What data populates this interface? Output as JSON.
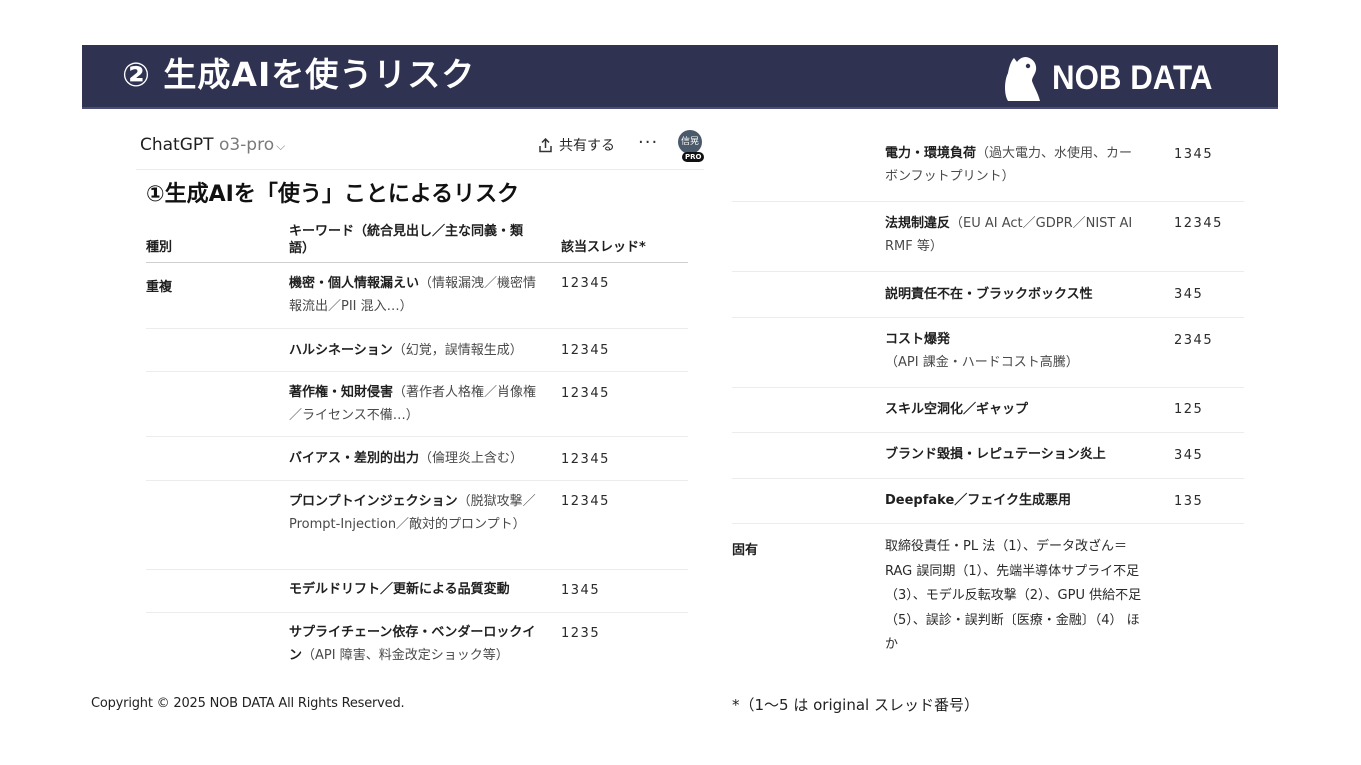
{
  "banner": {
    "title": "② 生成AIを使うリスク",
    "logo_text": "NOB DATA"
  },
  "chat": {
    "model_name": "ChatGPT",
    "model_version": "o3-pro",
    "share_label": "共有する",
    "more_label": "···",
    "avatar_text": "信晃",
    "pro_badge": "PRO",
    "heading": "①生成AIを「使う」ことによるリスク"
  },
  "table": {
    "headers": {
      "category": "種別",
      "keyword": "キーワード（統合見出し／主な同義・類語）",
      "threads": "該当スレッド*"
    },
    "rows": [
      {
        "category": "重複",
        "title": "機密・個人情報漏えい",
        "note": "（情報漏洩／機密情報流出／PII 混入…）",
        "threads": "12345"
      },
      {
        "category": "",
        "title": "ハルシネーション",
        "note": "（幻覚，誤情報生成）",
        "threads": "12345"
      },
      {
        "category": "",
        "title": "著作権・知財侵害",
        "note": "（著作者人格権／肖像権／ライセンス不備…）",
        "threads": "12345"
      },
      {
        "category": "",
        "title": "バイアス・差別的出力",
        "note": "（倫理炎上含む）",
        "threads": "12345"
      },
      {
        "category": "",
        "title": "プロンプトインジェクション",
        "note": "（脱獄攻撃／Prompt-Injection／敵対的プロンプト）",
        "threads": "12345"
      },
      {
        "category": "",
        "title": "モデルドリフト／更新による品質変動",
        "note": "",
        "threads": "1345"
      },
      {
        "category": "",
        "title": "サプライチェーン依存・ベンダーロックイン",
        "note": "（API 障害、料金改定ショック等）",
        "threads": "1235"
      },
      {
        "category": "",
        "title": "電力・環境負荷",
        "note": "（過大電力、水使用、カーボンフットプリント）",
        "threads": "1345"
      },
      {
        "category": "",
        "title": "法規制違反",
        "note": "（EU AI Act／GDPR／NIST AI RMF 等）",
        "threads": "12345"
      },
      {
        "category": "",
        "title": "説明責任不在・ブラックボックス性",
        "note": "",
        "threads": "345"
      },
      {
        "category": "",
        "title": "コスト爆発",
        "note": "（API 課金・ハードコスト高騰）",
        "threads": "2345"
      },
      {
        "category": "",
        "title": "スキル空洞化／ギャップ",
        "note": "",
        "threads": "125"
      },
      {
        "category": "",
        "title": "ブランド毀損・レピュテーション炎上",
        "note": "",
        "threads": "345"
      },
      {
        "category": "",
        "title": "Deepfake／フェイク生成悪用",
        "note": "",
        "threads": "135"
      },
      {
        "category": "固有",
        "title": "",
        "note": "取締役責任・PL 法（1）、データ改ざん＝RAG 誤同期（1）、先端半導体サプライ不足（3）、モデル反転攻撃（2）、GPU 供給不足（5）、誤診・誤判断〔医療・金融〕（4） ほか",
        "threads": ""
      }
    ]
  },
  "footer": {
    "copyright": "Copyright © 2025 NOB DATA All Rights Reserved.",
    "footnote": "*（1〜5 は original スレッド番号）"
  },
  "colors": {
    "banner_bg": "#2f3250",
    "text": "#1f1f1f"
  }
}
